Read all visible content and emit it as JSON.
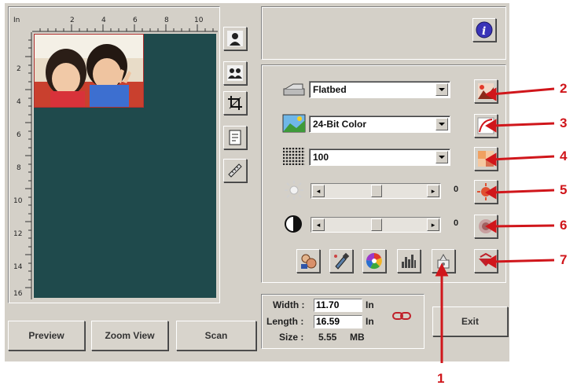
{
  "ruler": {
    "unit": "In",
    "top_ticks": [
      "2",
      "4",
      "6",
      "8",
      "10"
    ],
    "left_ticks": [
      "2",
      "4",
      "6",
      "8",
      "10",
      "12",
      "14",
      "16"
    ]
  },
  "buttons": {
    "preview": "Preview",
    "zoom_view": "Zoom View",
    "scan": "Scan",
    "exit": "Exit"
  },
  "settings": {
    "scan_source": "Flatbed",
    "image_type": "24-Bit Color",
    "resolution": "100",
    "brightness_value": "0",
    "contrast_value": "0",
    "brightness_level": 0.5,
    "contrast_level": 0.5
  },
  "dimensions": {
    "width_label": "Width :",
    "width_value": "11.70",
    "width_unit": "In",
    "length_label": "Length :",
    "length_value": "16.59",
    "length_unit": "In",
    "size_label": "Size :",
    "size_value": "5.55",
    "size_unit": "MB"
  },
  "callouts": [
    "1",
    "2",
    "3",
    "4",
    "5",
    "6",
    "7"
  ],
  "colors": {
    "window_bg": "#d4d0c8",
    "preview_bg": "#1f4a4c",
    "callout_red": "#d0161b",
    "info_blue": "#3a34b8"
  },
  "icons": {
    "tool_column": [
      "person-select-icon",
      "multi-person-icon",
      "crop-icon",
      "page-icon",
      "ruler-icon"
    ],
    "right_column": [
      "auto-adjust-icon",
      "curve-icon",
      "color-balance-icon",
      "brightness-icon",
      "contrast-icon",
      "color-drop-icon"
    ],
    "bottom_row": [
      "profile-icon",
      "eyedropper-icon",
      "color-wheel-icon",
      "histogram-icon",
      "descreen-icon"
    ]
  }
}
